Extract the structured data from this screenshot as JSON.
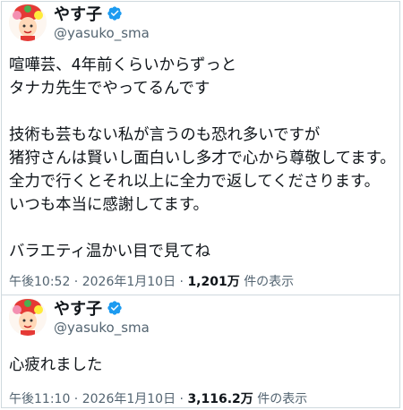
{
  "tweets": [
    {
      "author_name": "やす子",
      "handle": "@yasuko_sma",
      "body": "喧嘩芸、4年前くらいからずっと\nタナカ先生でやってるんです\n\n技術も芸もない私が言うのも恐れ多いですが\n猪狩さんは賢いし面白いし多才で心から尊敬してます。\n全力で行くとそれ以上に全力で返してくださります。\nいつも本当に感謝してます。\n\nバラエティ温かい目で見てね",
      "time": "午後10:52",
      "date": "2026年1月10日",
      "views_count": "1,201万",
      "views_label": "件の表示"
    },
    {
      "author_name": "やす子",
      "handle": "@yasuko_sma",
      "body": "心疲れました",
      "time": "午後11:10",
      "date": "2026年1月10日",
      "views_count": "3,116.2万",
      "views_label": "件の表示"
    }
  ],
  "separator": " · ",
  "icons": {
    "verified": "verified-badge-icon"
  },
  "colors": {
    "verified_blue": "#1d9bf0",
    "secondary_text": "#536471",
    "border": "#cfd9de"
  }
}
